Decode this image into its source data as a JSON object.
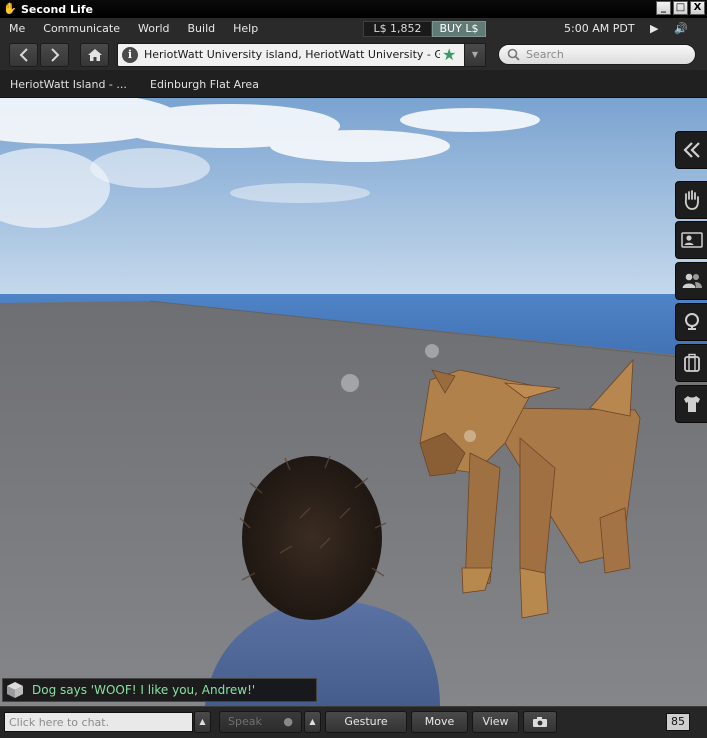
{
  "window": {
    "title": "Second Life",
    "buttons": [
      "_",
      "□",
      "X"
    ]
  },
  "menu": {
    "items": [
      "Me",
      "Communicate",
      "World",
      "Build",
      "Help"
    ],
    "balance": "L$ 1,852",
    "buy_label": "BUY L$",
    "clock": "5:00 AM PDT",
    "media_controls": "▶ 🔊"
  },
  "navbar": {
    "location": "HeriotWatt University island, HeriotWatt University - Gen",
    "info_glyph": "i",
    "star_glyph": "★",
    "search_placeholder": "Search"
  },
  "favorites": [
    "HeriotWatt Island - ...",
    "Edinburgh Flat Area"
  ],
  "chat_toast": {
    "message": "Dog says 'WOOF! I like you, Andrew!'"
  },
  "tray": {
    "chat_placeholder": "Click here to chat.",
    "speak_label": "Speak",
    "gesture_label": "Gesture",
    "move_label": "Move",
    "view_label": "View",
    "count": "85"
  },
  "sidebar": {
    "tabs": [
      "collapse-icon",
      "hand-icon",
      "profile-icon",
      "people-icon",
      "places-icon",
      "inventory-icon",
      "appearance-icon"
    ]
  },
  "colors": {
    "sky_top": "#7fa6d2",
    "sea": "#5486c8",
    "ground": "#7a7b7d",
    "dog": "#a57442",
    "shirt": "#4f6796",
    "toast_text": "#88e0a0",
    "buy_button": "#627a76"
  }
}
